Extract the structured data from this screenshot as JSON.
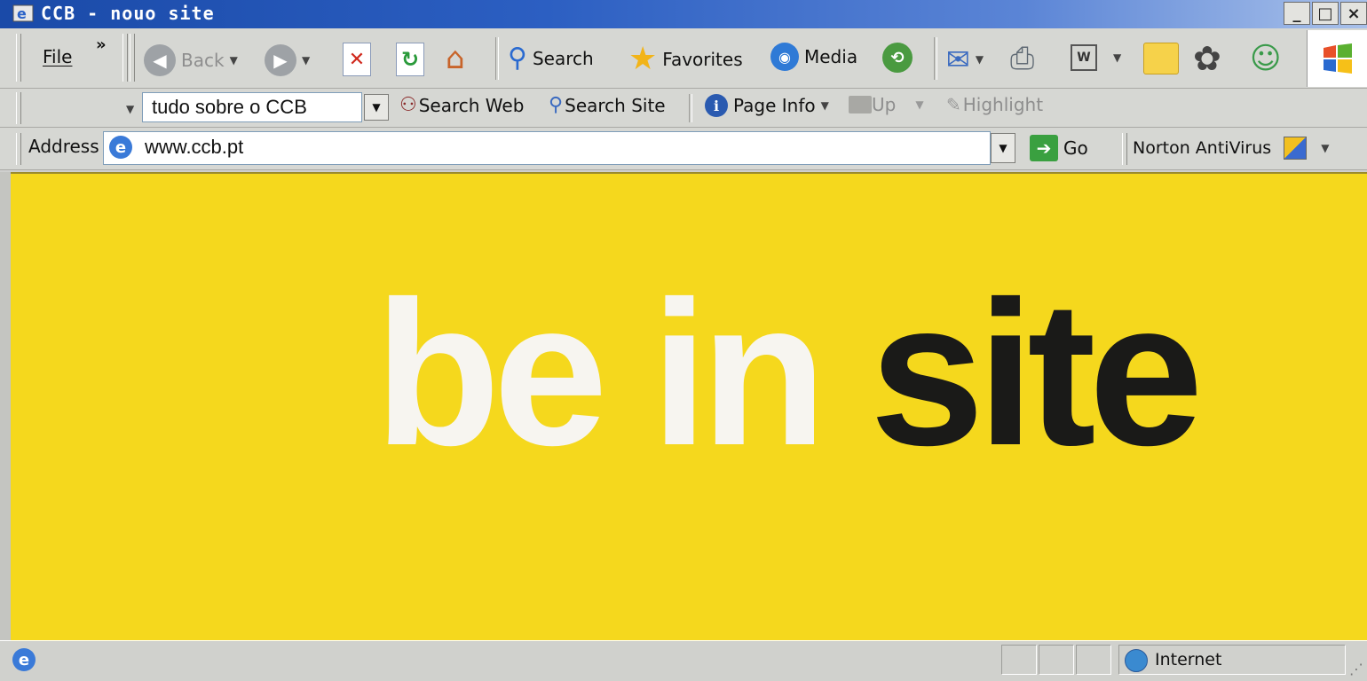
{
  "window": {
    "title": "CCB - nouo site",
    "minimize": "_",
    "maximize": "□",
    "close": "×"
  },
  "toolbar": {
    "file_menu": "File",
    "chevron": "»",
    "back_label": "Back",
    "search_label": "Search",
    "favorites_label": "Favorites",
    "media_label": "Media"
  },
  "search_toolbar": {
    "query": "tudo sobre o CCB",
    "search_web": "Search Web",
    "search_site": "Search Site",
    "page_info": "Page Info",
    "up": "Up",
    "highlight": "Highlight"
  },
  "address_bar": {
    "label": "Address",
    "url": "www.ccb.pt",
    "go": "Go",
    "norton": "Norton AntiVirus"
  },
  "content": {
    "word1": "be",
    "word2": "in",
    "word3": "site",
    "background": "#f5d81d"
  },
  "status": {
    "zone": "Internet"
  }
}
